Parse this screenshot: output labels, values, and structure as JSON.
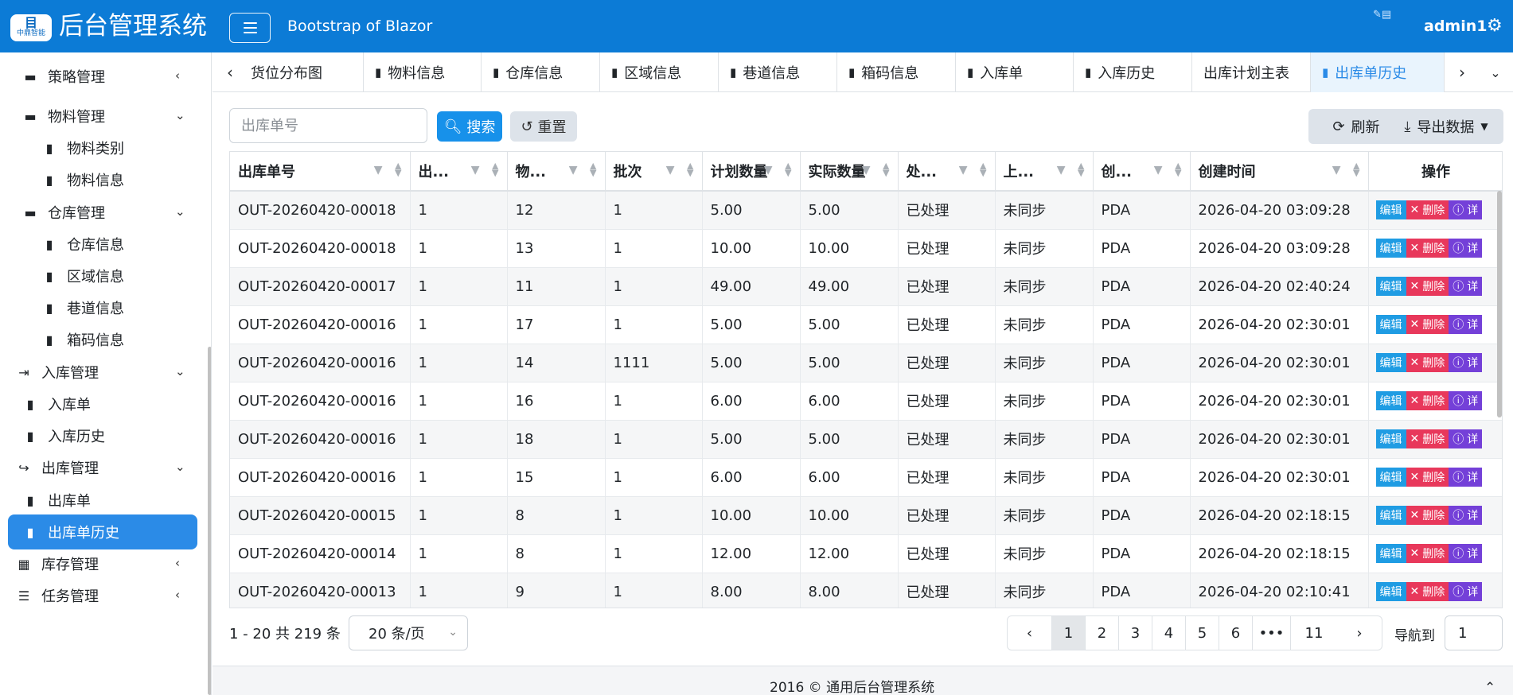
{
  "header": {
    "logo_text": "中鼎智能",
    "app_title": "后台管理系统",
    "subtitle": "Bootstrap of Blazor",
    "username": "admin1",
    "icons": {
      "menu": "hamburger-icon",
      "settings": "gears-icon"
    }
  },
  "sidebar": {
    "items": [
      {
        "label": "策略管理",
        "icon": "folder-icon",
        "chevron": "‹",
        "level": 1
      },
      {
        "label": "物料管理",
        "icon": "folder-icon",
        "chevron": "⌄",
        "level": 1
      },
      {
        "label": "物料类别",
        "icon": "file-icon",
        "level": 2
      },
      {
        "label": "物料信息",
        "icon": "file-icon",
        "level": 2
      },
      {
        "label": "仓库管理",
        "icon": "folder-icon",
        "chevron": "⌄",
        "level": 1
      },
      {
        "label": "仓库信息",
        "icon": "file-icon",
        "level": 2
      },
      {
        "label": "区域信息",
        "icon": "file-icon",
        "level": 2
      },
      {
        "label": "巷道信息",
        "icon": "file-icon",
        "level": 2
      },
      {
        "label": "箱码信息",
        "icon": "file-icon",
        "level": 2
      },
      {
        "label": "入库管理",
        "icon": "sign-in-icon",
        "chevron": "⌄",
        "level": 0
      },
      {
        "label": "入库单",
        "icon": "file-icon",
        "level": 1
      },
      {
        "label": "入库历史",
        "icon": "file-icon",
        "level": 1
      },
      {
        "label": "出库管理",
        "icon": "sign-out-icon",
        "chevron": "⌄",
        "level": 0
      },
      {
        "label": "出库单",
        "icon": "file-icon",
        "level": 1
      },
      {
        "label": "出库单历史",
        "icon": "file-icon",
        "level": 1,
        "active": true
      },
      {
        "label": "库存管理",
        "icon": "boxes-icon",
        "chevron": "‹",
        "level": 0
      },
      {
        "label": "任务管理",
        "icon": "list-icon",
        "chevron": "‹",
        "level": 0
      }
    ]
  },
  "tabs": [
    {
      "label": "货位分布图",
      "icon": false
    },
    {
      "label": "物料信息",
      "icon": true
    },
    {
      "label": "仓库信息",
      "icon": true
    },
    {
      "label": "区域信息",
      "icon": true
    },
    {
      "label": "巷道信息",
      "icon": true
    },
    {
      "label": "箱码信息",
      "icon": true
    },
    {
      "label": "入库单",
      "icon": true
    },
    {
      "label": "入库历史",
      "icon": true
    },
    {
      "label": "出库计划主表",
      "icon": false
    },
    {
      "label": "出库单历史",
      "icon": true,
      "active": true
    }
  ],
  "toolbar": {
    "search_placeholder": "出库单号",
    "search_label": "搜索",
    "reset_label": "重置",
    "refresh_label": "刷新",
    "export_label": "导出数据"
  },
  "table": {
    "columns": [
      "出库单号",
      "出...",
      "物...",
      "批次",
      "计划数量",
      "实际数量",
      "处...",
      "上...",
      "创...",
      "创建时间",
      "操作"
    ],
    "actions": {
      "edit": "编辑",
      "delete": "删除",
      "info": "详"
    },
    "rows": [
      [
        "OUT-20260420-00018",
        "1",
        "12",
        "1",
        "5.00",
        "5.00",
        "已处理",
        "未同步",
        "PDA",
        "2026-04-20 03:09:28"
      ],
      [
        "OUT-20260420-00018",
        "1",
        "13",
        "1",
        "10.00",
        "10.00",
        "已处理",
        "未同步",
        "PDA",
        "2026-04-20 03:09:28"
      ],
      [
        "OUT-20260420-00017",
        "1",
        "11",
        "1",
        "49.00",
        "49.00",
        "已处理",
        "未同步",
        "PDA",
        "2026-04-20 02:40:24"
      ],
      [
        "OUT-20260420-00016",
        "1",
        "17",
        "1",
        "5.00",
        "5.00",
        "已处理",
        "未同步",
        "PDA",
        "2026-04-20 02:30:01"
      ],
      [
        "OUT-20260420-00016",
        "1",
        "14",
        "1111",
        "5.00",
        "5.00",
        "已处理",
        "未同步",
        "PDA",
        "2026-04-20 02:30:01"
      ],
      [
        "OUT-20260420-00016",
        "1",
        "16",
        "1",
        "6.00",
        "6.00",
        "已处理",
        "未同步",
        "PDA",
        "2026-04-20 02:30:01"
      ],
      [
        "OUT-20260420-00016",
        "1",
        "18",
        "1",
        "5.00",
        "5.00",
        "已处理",
        "未同步",
        "PDA",
        "2026-04-20 02:30:01"
      ],
      [
        "OUT-20260420-00016",
        "1",
        "15",
        "1",
        "6.00",
        "6.00",
        "已处理",
        "未同步",
        "PDA",
        "2026-04-20 02:30:01"
      ],
      [
        "OUT-20260420-00015",
        "1",
        "8",
        "1",
        "10.00",
        "10.00",
        "已处理",
        "未同步",
        "PDA",
        "2026-04-20 02:18:15"
      ],
      [
        "OUT-20260420-00014",
        "1",
        "8",
        "1",
        "12.00",
        "12.00",
        "已处理",
        "未同步",
        "PDA",
        "2026-04-20 02:18:15"
      ],
      [
        "OUT-20260420-00013",
        "1",
        "9",
        "1",
        "8.00",
        "8.00",
        "已处理",
        "未同步",
        "PDA",
        "2026-04-20 02:10:41"
      ]
    ]
  },
  "pagination": {
    "info": "1 - 20 共 219 条",
    "page_size": "20 条/页",
    "pages": [
      "1",
      "2",
      "3",
      "4",
      "5",
      "6",
      "•••",
      "11"
    ],
    "current": "1",
    "goto_label": "导航到",
    "goto_value": "1"
  },
  "footer": {
    "text": "2016 © 通用后台管理系统"
  },
  "colors": {
    "primary": "#0c7bd6",
    "active": "#2b8be7",
    "edit": "#1f9ce3",
    "delete": "#e8385b",
    "info": "#7440d8"
  }
}
